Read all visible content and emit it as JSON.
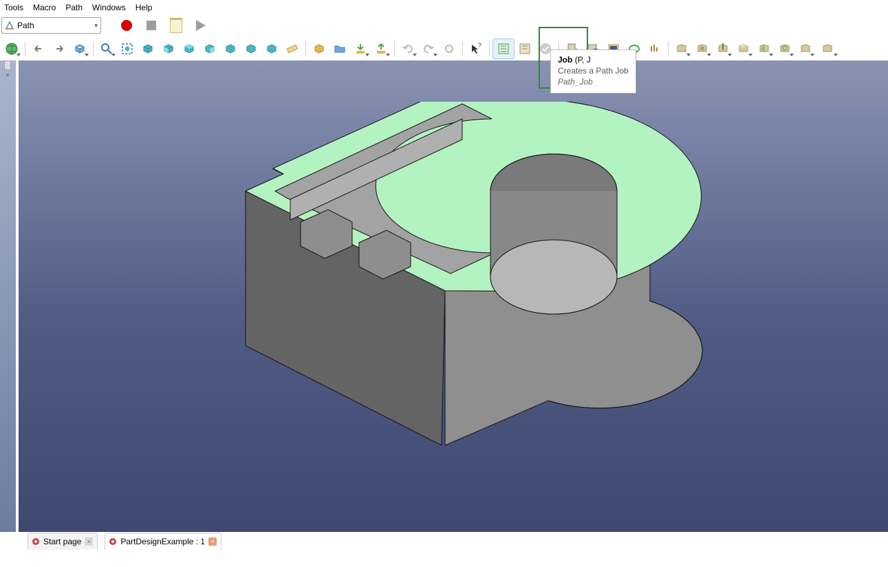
{
  "menus": {
    "tools": "Tools",
    "macro": "Macro",
    "path": "Path",
    "windows": "Windows",
    "help": "Help"
  },
  "workbench": "Path",
  "tooltip": {
    "title": "Job",
    "shortcut": "(P, J",
    "desc": "Creates a Path Job",
    "cmd": "Path_Job"
  },
  "tabs": {
    "start": "Start page",
    "doc": "PartDesignExample : 1"
  },
  "icons": {
    "nav_back": "back",
    "nav_fwd": "forward",
    "link": "link",
    "zoom": "zoom",
    "fit": "fit-all",
    "iso": "iso",
    "front": "front",
    "top": "top",
    "right": "right",
    "rear": "rear",
    "bottom": "bottom",
    "left": "left",
    "ruler": "measure",
    "part": "part",
    "open": "open",
    "import": "import",
    "export": "export",
    "undo": "undo",
    "redo": "redo",
    "refresh": "refresh",
    "whatsthis": "whatsthis",
    "job": "job",
    "post": "post",
    "check": "check",
    "export2": "export",
    "sim": "simulate",
    "tool": "toolbit",
    "tool2": "toolcontroller",
    "cycle": "cycle",
    "profile": "profile",
    "pocket": "pocket",
    "drill": "drill",
    "face": "face",
    "helix": "helix",
    "adaptive": "adaptive",
    "slot": "slot",
    "engrave": "engrave",
    "deburr": "deburr"
  }
}
